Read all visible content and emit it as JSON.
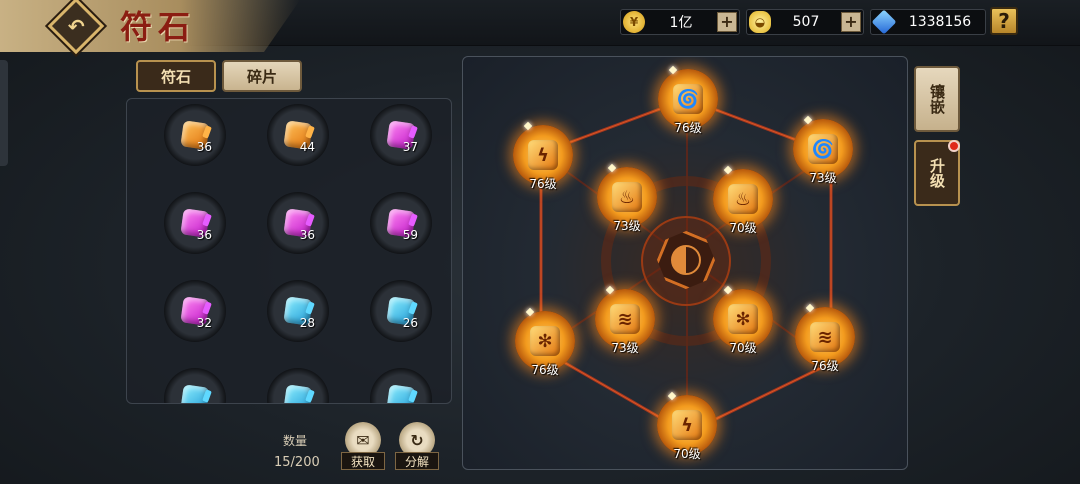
{
  "header": {
    "title": "符石",
    "resources": [
      {
        "icon": "gold-coin-icon",
        "value": "1亿"
      },
      {
        "icon": "gold-ingot-icon",
        "value": "507"
      },
      {
        "icon": "blue-crystal-icon",
        "value": "1338156"
      }
    ],
    "help_label": "?"
  },
  "tabs": [
    {
      "label": "符石",
      "active": false
    },
    {
      "label": "碎片",
      "active": true
    }
  ],
  "fragments": [
    {
      "color": "orange",
      "count": "36"
    },
    {
      "color": "orange",
      "count": "44"
    },
    {
      "color": "purple",
      "count": "37"
    },
    {
      "color": "purple",
      "count": "36"
    },
    {
      "color": "purple",
      "count": "36"
    },
    {
      "color": "purple",
      "count": "59"
    },
    {
      "color": "purple",
      "count": "32"
    },
    {
      "color": "blue",
      "count": "28"
    },
    {
      "color": "blue",
      "count": "26"
    },
    {
      "color": "blue",
      "count": ""
    },
    {
      "color": "blue",
      "count": ""
    },
    {
      "color": "blue",
      "count": ""
    }
  ],
  "inventory": {
    "label": "数量",
    "value": "15/200"
  },
  "actions": {
    "obtain": "获取",
    "decompose": "分解"
  },
  "rune_nodes": [
    {
      "slot": "top",
      "symbol": "tornado",
      "level": "76级"
    },
    {
      "slot": "upper-left",
      "symbol": "lightning",
      "level": "76级"
    },
    {
      "slot": "upper-right",
      "symbol": "tornado",
      "level": "73级"
    },
    {
      "slot": "inner-upper-left",
      "symbol": "fire",
      "level": "73级"
    },
    {
      "slot": "inner-upper-right",
      "symbol": "fire",
      "level": "70级"
    },
    {
      "slot": "inner-lower-left",
      "symbol": "feather",
      "level": "73级"
    },
    {
      "slot": "inner-lower-right",
      "symbol": "snowflake",
      "level": "70级"
    },
    {
      "slot": "lower-left",
      "symbol": "snowflake",
      "level": "76级"
    },
    {
      "slot": "lower-right",
      "symbol": "feather",
      "level": "76级"
    },
    {
      "slot": "bottom",
      "symbol": "lightning",
      "level": "70级"
    }
  ],
  "side_buttons": {
    "inlay": "镶嵌",
    "upgrade": "升级"
  },
  "colors": {
    "accent": "#f39b1e",
    "title": "#8b1d12",
    "notify": "#e02a1a"
  }
}
